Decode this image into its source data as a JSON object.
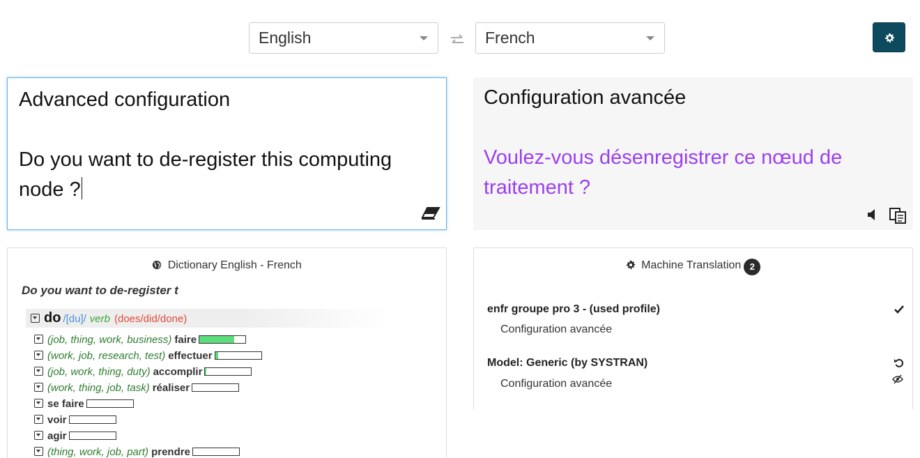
{
  "languages": {
    "source": "English",
    "target": "French",
    "swap_icon": "swap-arrows-icon"
  },
  "settings": {
    "icon": "gear-icon",
    "color": "#0d4a5e"
  },
  "source": {
    "line1": "Advanced configuration",
    "line2": "Do you want to de-register this computing node ?",
    "clear_icon": "eraser-icon"
  },
  "target": {
    "line1": "Configuration avancée",
    "line2": "Voulez-vous désenregistrer ce nœud de traitement ?",
    "highlight_color": "#9a3ff2",
    "speaker_icon": "speaker-icon",
    "copy_icon": "copy-icon"
  },
  "dictionary": {
    "title": "Dictionary English - French",
    "query": "Do you want to de-register t",
    "entry": {
      "word": "do",
      "phonetic": "/[du]/",
      "pos": "verb",
      "forms": "(does/did/done)"
    },
    "senses": [
      {
        "context": "(job, thing, work, business)",
        "translation": "faire",
        "frequency": 0.75
      },
      {
        "context": "(work, job, research, test)",
        "translation": "effectuer",
        "frequency": 0.06
      },
      {
        "context": "(job, work, thing, duty)",
        "translation": "accomplir",
        "frequency": 0.03
      },
      {
        "context": "(work, thing, job, task)",
        "translation": "réaliser",
        "frequency": 0.0
      },
      {
        "context": "",
        "translation": "se faire",
        "frequency": 0.0
      },
      {
        "context": "",
        "translation": "voir",
        "frequency": 0.0
      },
      {
        "context": "",
        "translation": "agir",
        "frequency": 0.0
      },
      {
        "context": "(thing, work, job, part)",
        "translation": "prendre",
        "frequency": 0.0
      }
    ]
  },
  "machine_translation": {
    "title": "Machine Translation",
    "count": "2",
    "items": [
      {
        "title": "enfr groupe pro 3 - (used profile)",
        "text": "Configuration avancée",
        "icon": "checkmark-icon"
      },
      {
        "title": "Model: Generic (by SYSTRAN)",
        "text": "Configuration avancée",
        "icon": "reset-icon",
        "secondary_icon": "eye-slash-icon"
      }
    ]
  }
}
